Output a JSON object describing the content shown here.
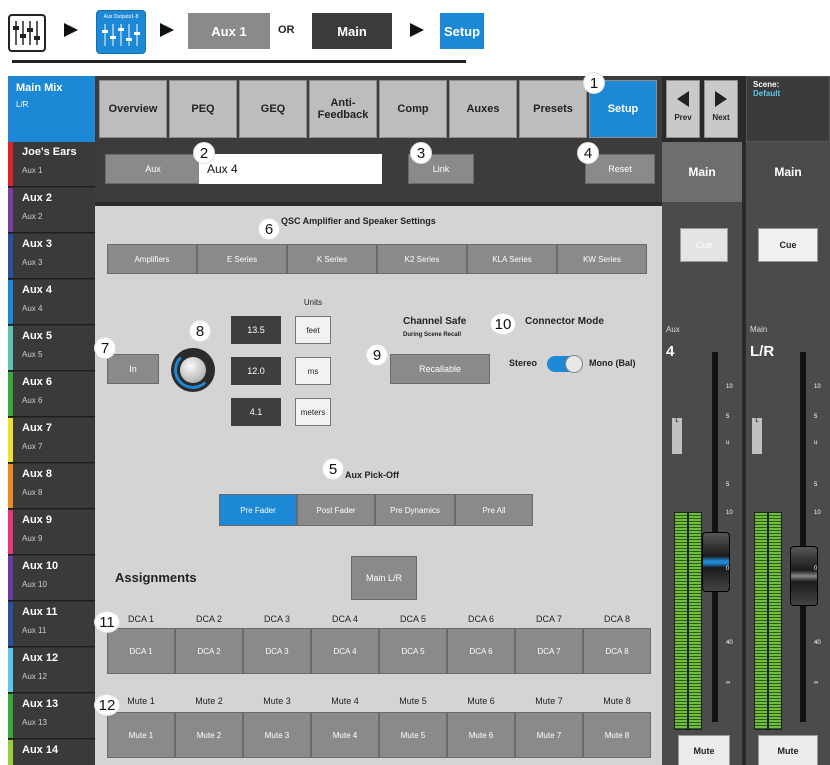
{
  "breadcrumb": {
    "icon2_label": "Aux Outputs1-8",
    "aux1": "Aux 1",
    "or": "OR",
    "main": "Main",
    "setup": "Setup"
  },
  "sidebar": {
    "main_mix": {
      "title": "Main Mix",
      "sub": "L/R"
    },
    "channels": [
      {
        "name": "Joe's Ears",
        "aux": "Aux 1",
        "color": "#d9242b"
      },
      {
        "name": "Aux 2",
        "aux": "Aux 2",
        "color": "#7a3fa0"
      },
      {
        "name": "Aux 3",
        "aux": "Aux 3",
        "color": "#2c4f9e"
      },
      {
        "name": "Aux 4",
        "aux": "Aux 4",
        "color": "#1d89d6"
      },
      {
        "name": "Aux 5",
        "aux": "Aux 5",
        "color": "#5ec2b0"
      },
      {
        "name": "Aux 6",
        "aux": "Aux 6",
        "color": "#3aa63a"
      },
      {
        "name": "Aux 7",
        "aux": "Aux 7",
        "color": "#f2e227"
      },
      {
        "name": "Aux 8",
        "aux": "Aux 8",
        "color": "#f08a1c"
      },
      {
        "name": "Aux 9",
        "aux": "Aux 9",
        "color": "#e6357a"
      },
      {
        "name": "Aux 10",
        "aux": "Aux 10",
        "color": "#6a3aa0"
      },
      {
        "name": "Aux 11",
        "aux": "Aux 11",
        "color": "#2c4f9e"
      },
      {
        "name": "Aux 12",
        "aux": "Aux 12",
        "color": "#5bc8e8"
      },
      {
        "name": "Aux 13",
        "aux": "Aux 13",
        "color": "#3aa63a"
      },
      {
        "name": "Aux 14",
        "aux": "",
        "color": "#9ccc3c"
      }
    ]
  },
  "tabs": [
    "Overview",
    "PEQ",
    "GEQ",
    "Anti-\nFeedback",
    "Comp",
    "Auxes",
    "Presets",
    "Setup"
  ],
  "nav": {
    "prev": "Prev",
    "next": "Next"
  },
  "scene": {
    "label": "Scene:",
    "value": "Default"
  },
  "aux_row": {
    "aux_btn": "Aux",
    "aux_name": "Aux 4",
    "link": "Link",
    "reset": "Reset"
  },
  "qsc": {
    "title": "QSC Amplifier and Speaker Settings",
    "series": [
      "Amplifiers",
      "E Series",
      "K Series",
      "K2 Series",
      "KLA Series",
      "KW Series"
    ]
  },
  "delay": {
    "in_btn": "In",
    "units_label": "Units",
    "values": [
      "13.5",
      "12.0",
      "4.1"
    ],
    "units": [
      "feet",
      "ms",
      "meters"
    ]
  },
  "channel_safe": {
    "title": "Channel Safe",
    "sub": "During Scene Recall",
    "btn": "Recallable"
  },
  "connector": {
    "title": "Connector Mode",
    "stereo": "Stereo",
    "mono": "Mono (Bal)"
  },
  "pickoff": {
    "title": "Aux Pick-Off",
    "options": [
      "Pre Fader",
      "Post Fader",
      "Pre Dynamics",
      "Pre All"
    ]
  },
  "assignments": {
    "title": "Assignments",
    "main_lr": "Main L/R",
    "dca_labels": [
      "DCA 1",
      "DCA 2",
      "DCA 3",
      "DCA 4",
      "DCA 5",
      "DCA 6",
      "DCA 7",
      "DCA 8"
    ],
    "mute_labels": [
      "Mute 1",
      "Mute 2",
      "Mute 3",
      "Mute 4",
      "Mute 5",
      "Mute 6",
      "Mute 7",
      "Mute 8"
    ]
  },
  "strips": {
    "aux": {
      "head": "Main",
      "cue": "Cue",
      "name": "Aux",
      "num": "4",
      "l": "L",
      "mute": "Mute"
    },
    "main": {
      "head": "Main",
      "cue": "Cue",
      "name": "Main",
      "num": "L/R",
      "l": "L",
      "mute": "Mute"
    },
    "scale": [
      "10",
      "5",
      "u",
      "5",
      "10",
      "0",
      "40",
      "∞"
    ]
  },
  "callouts": [
    "1",
    "2",
    "3",
    "4",
    "5",
    "6",
    "7",
    "8",
    "9",
    "10",
    "11",
    "12"
  ]
}
